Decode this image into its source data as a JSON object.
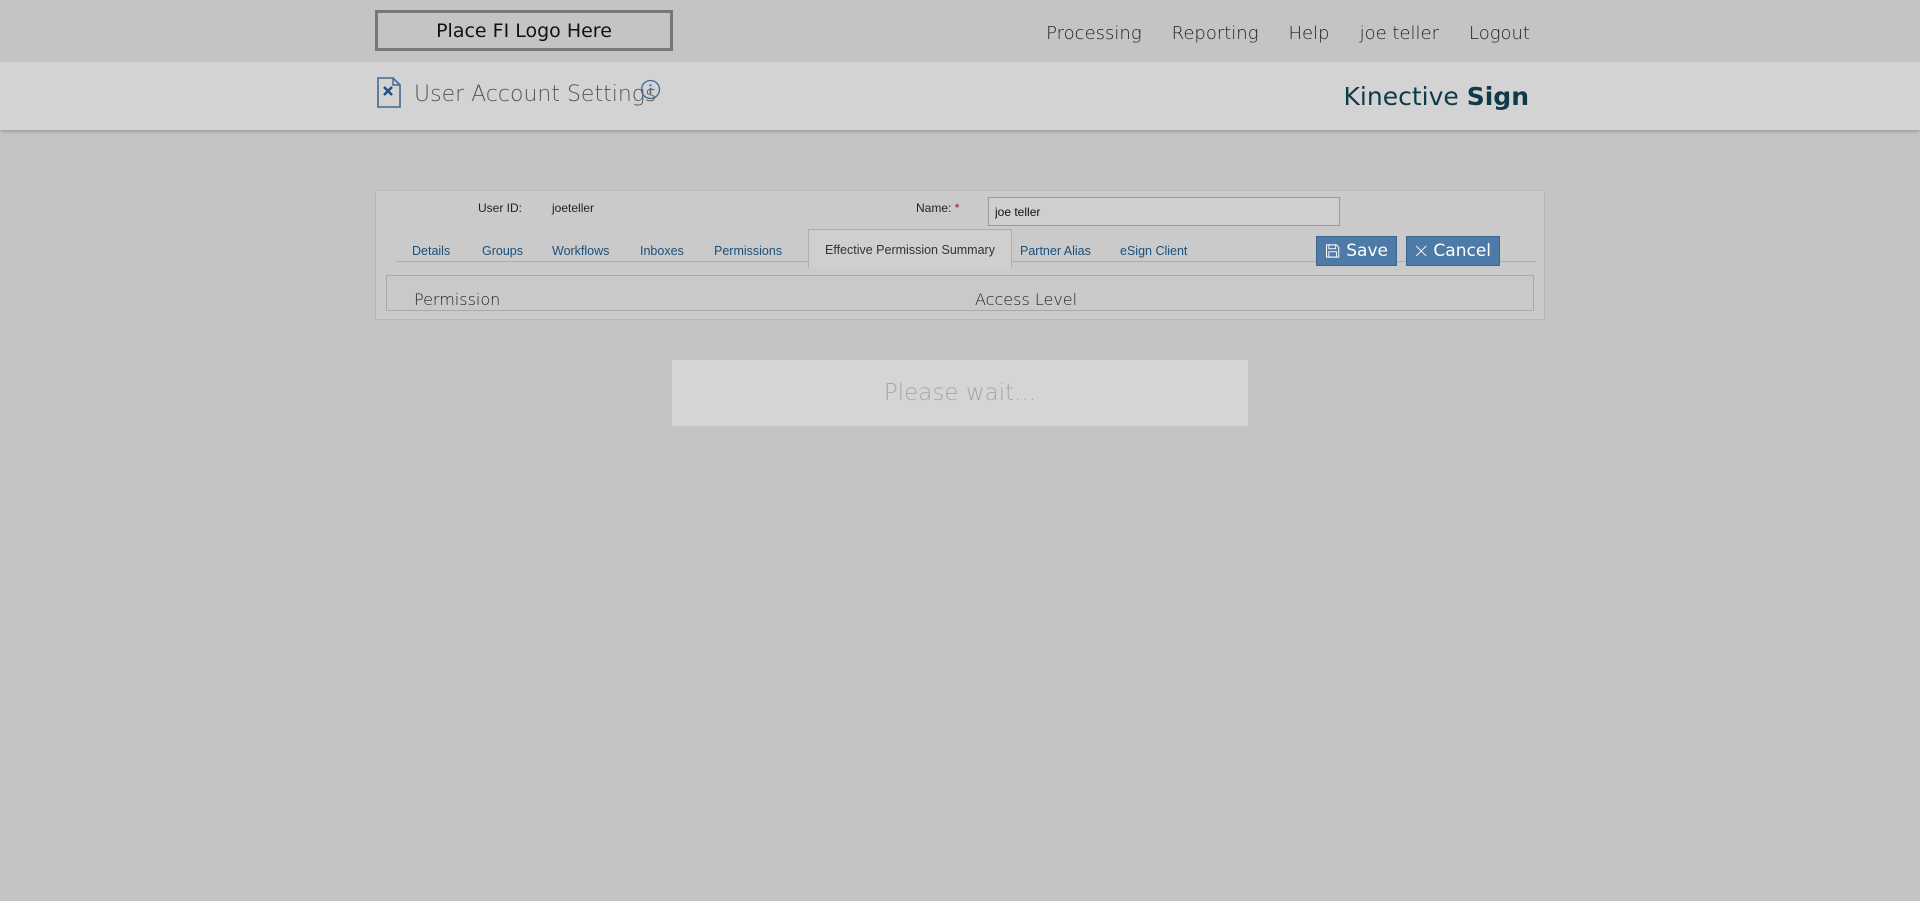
{
  "topbar": {
    "logo_text": "Place FI Logo Here",
    "nav": [
      "Processing",
      "Reporting",
      "Help",
      "joe teller",
      "Logout"
    ]
  },
  "header": {
    "title": "User Account Settings",
    "brand_light": "Kinective",
    "brand_bold": "Sign",
    "brand_color": "#0e3a4a"
  },
  "form": {
    "user_id_label": "User ID:",
    "user_id_value": "joeteller",
    "name_label": "Name:",
    "required_mark": "*",
    "name_value": "joe teller"
  },
  "tabs": [
    {
      "label": "Details"
    },
    {
      "label": "Groups"
    },
    {
      "label": "Workflows"
    },
    {
      "label": "Inboxes"
    },
    {
      "label": "Permissions"
    },
    {
      "label": "Effective Permission Summary",
      "active": true
    },
    {
      "label": "Partner Alias"
    },
    {
      "label": "eSign Client"
    }
  ],
  "buttons": {
    "save_label": "Save",
    "cancel_label": "Cancel",
    "accent_color": "#4d7aa7"
  },
  "table": {
    "columns": [
      "Permission",
      "Access Level"
    ]
  },
  "status": {
    "wait_text": "Please wait..."
  }
}
